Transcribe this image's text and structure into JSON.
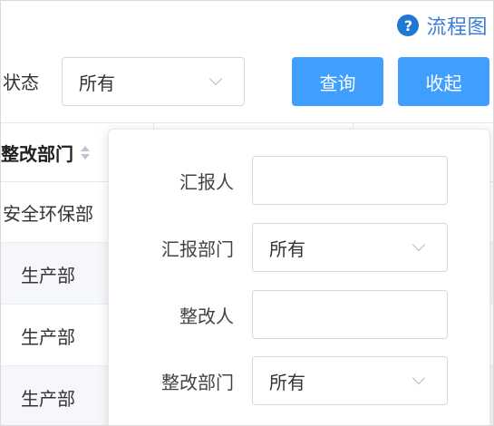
{
  "header": {
    "flow_link": "流程图",
    "help_icon": "?"
  },
  "filters": {
    "status_label": "状态",
    "status_value": "所有",
    "query_button": "查询",
    "collapse_button": "收起"
  },
  "table": {
    "columns": [
      "整改部门"
    ],
    "rows": [
      {
        "dept": "安全环保部"
      },
      {
        "dept": "生产部"
      },
      {
        "dept": "生产部"
      },
      {
        "dept": "生产部"
      }
    ]
  },
  "popover": {
    "fields": [
      {
        "label": "汇报人",
        "type": "input",
        "value": ""
      },
      {
        "label": "汇报部门",
        "type": "select",
        "value": "所有"
      },
      {
        "label": "整改人",
        "type": "input",
        "value": ""
      },
      {
        "label": "整改部门",
        "type": "select",
        "value": "所有"
      }
    ]
  }
}
